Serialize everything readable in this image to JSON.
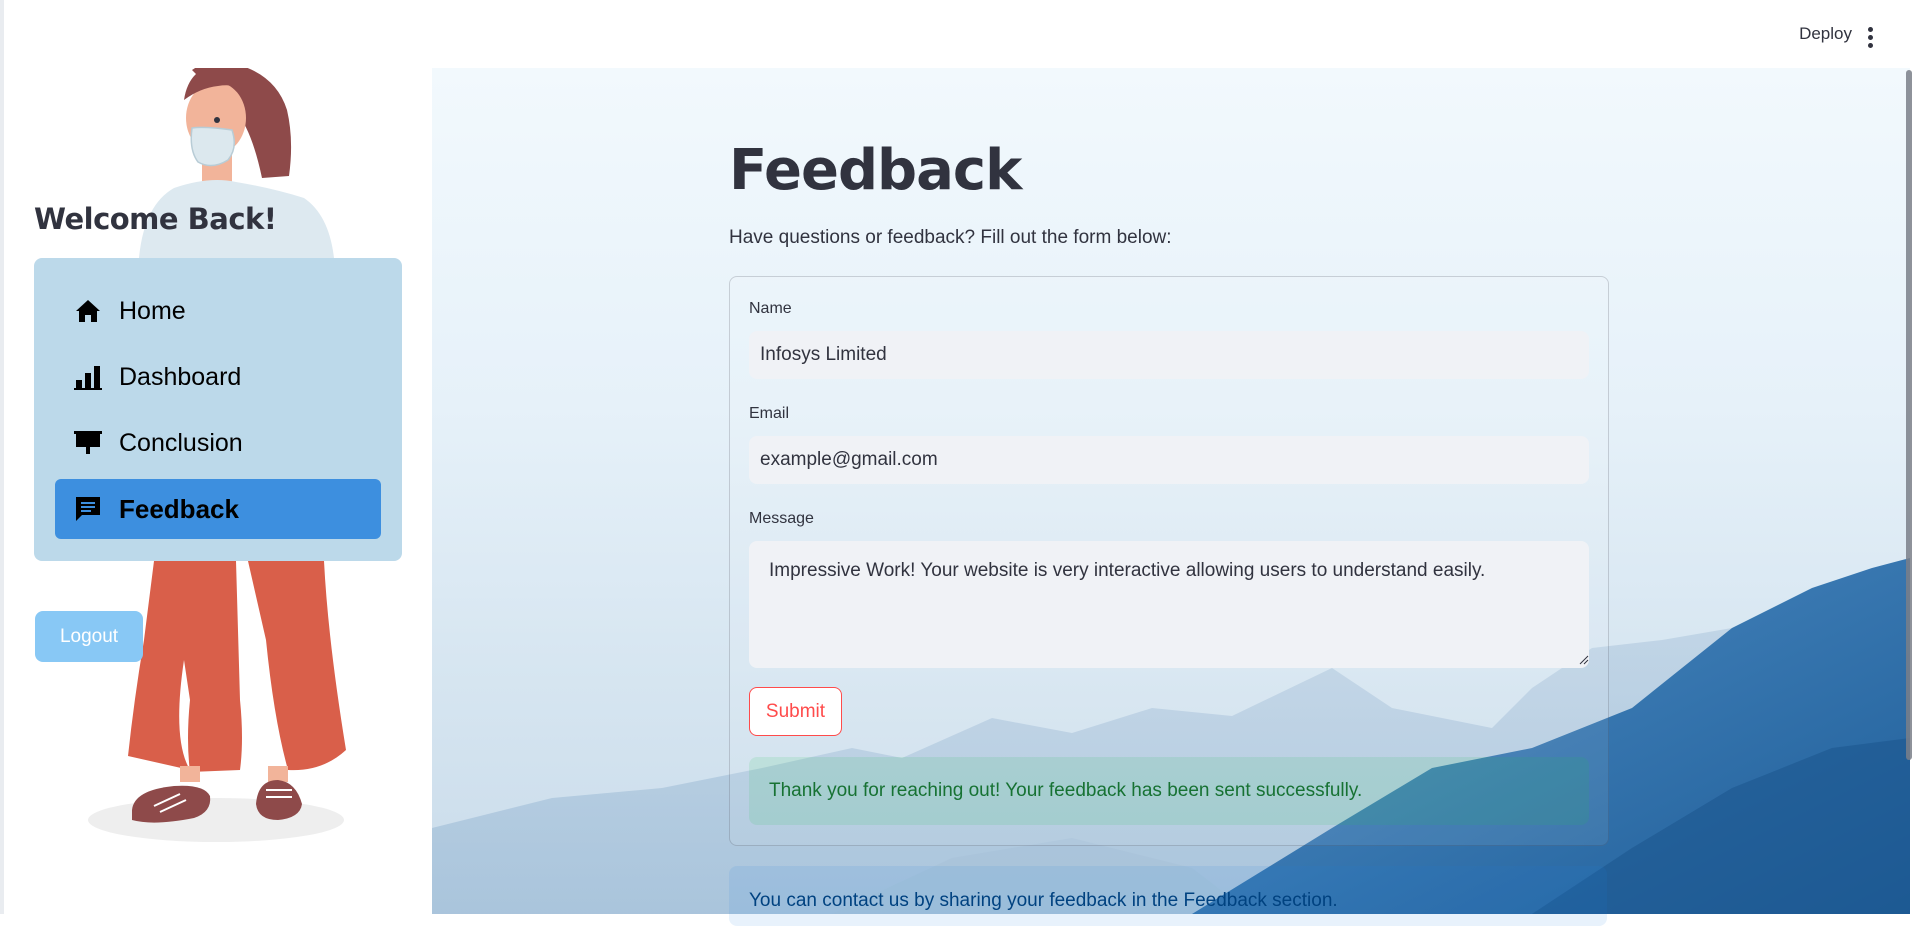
{
  "header": {
    "deploy_label": "Deploy",
    "menu_icon": "kebab-menu-icon"
  },
  "sidebar": {
    "welcome": "Welcome Back!",
    "nav": [
      {
        "label": "Home",
        "icon": "home-icon",
        "active": false
      },
      {
        "label": "Dashboard",
        "icon": "bar-chart-icon",
        "active": false
      },
      {
        "label": "Conclusion",
        "icon": "presentation-icon",
        "active": false
      },
      {
        "label": "Feedback",
        "icon": "chat-icon",
        "active": true
      }
    ],
    "logout_label": "Logout"
  },
  "main": {
    "title": "Feedback",
    "subtitle": "Have questions or feedback? Fill out the form below:",
    "form": {
      "name_label": "Name",
      "name_value": "Infosys Limited",
      "email_label": "Email",
      "email_value": "example@gmail.com",
      "message_label": "Message",
      "message_value": "Impressive Work! Your website is very interactive allowing users to understand easily.",
      "submit_label": "Submit"
    },
    "success_message": "Thank you for reaching out! Your feedback has been sent successfully.",
    "info_message": "You can contact us by sharing your feedback in the Feedback section."
  },
  "colors": {
    "nav_background": "#bcd9ea",
    "nav_active": "#3d8fdf",
    "logout_button": "#88c8f5",
    "submit_border": "#ff4b4b",
    "success_text": "#177233",
    "info_text": "#004280"
  }
}
